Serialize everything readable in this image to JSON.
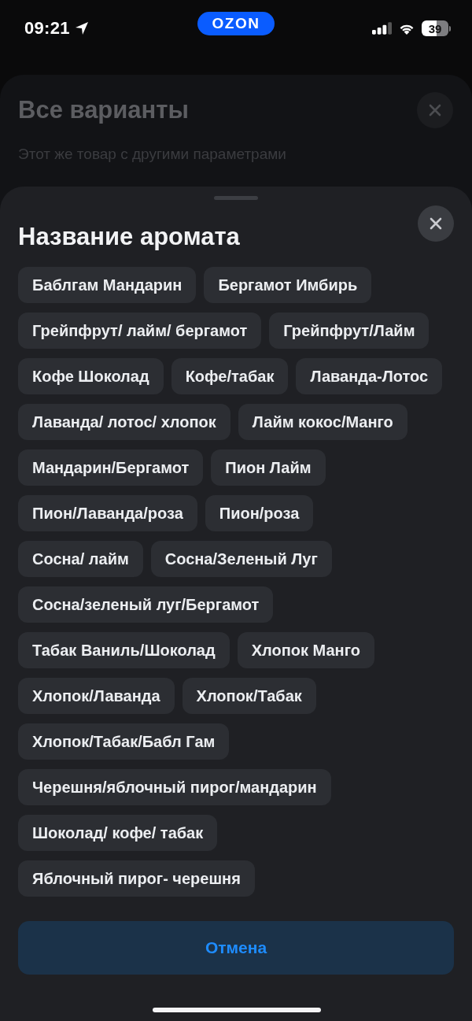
{
  "status_bar": {
    "time": "09:21",
    "app_badge": "OZON",
    "battery": "39"
  },
  "background_sheet": {
    "title": "Все варианты",
    "subtitle": "Этот же товар с другими параметрами"
  },
  "sheet": {
    "title": "Название аромата",
    "options": [
      {
        "label": "Баблгам Мандарин",
        "selected": false
      },
      {
        "label": "Бергамот Имбирь",
        "selected": false
      },
      {
        "label": "Грейпфрут/ лайм/ бергамот",
        "selected": false
      },
      {
        "label": "Грейпфрут/Лайм",
        "selected": false
      },
      {
        "label": "Кофе Шоколад",
        "selected": false
      },
      {
        "label": "Кофе/табак",
        "selected": false
      },
      {
        "label": "Лаванда-Лотос",
        "selected": false
      },
      {
        "label": "Лаванда/ лотос/ хлопок",
        "selected": false
      },
      {
        "label": "Лайм кокос/Манго",
        "selected": false
      },
      {
        "label": "Мандарин/Бергамот",
        "selected": false
      },
      {
        "label": "Пион Лайм",
        "selected": false
      },
      {
        "label": "Пион/Лаванда/роза",
        "selected": false
      },
      {
        "label": "Пион/роза",
        "selected": false
      },
      {
        "label": "Сосна/ лайм",
        "selected": false
      },
      {
        "label": "Сосна/Зеленый Луг",
        "selected": false
      },
      {
        "label": "Сосна/зеленый луг/Бергамот",
        "selected": false
      },
      {
        "label": "Табак Ваниль/Шоколад",
        "selected": false
      },
      {
        "label": "Хлопок Манго",
        "selected": false
      },
      {
        "label": "Хлопок/Лаванда",
        "selected": false
      },
      {
        "label": "Хлопок/Табак",
        "selected": false
      },
      {
        "label": "Хлопок/Табак/Бабл Гам",
        "selected": false
      },
      {
        "label": "Черешня/яблочный пирог/мандарин",
        "selected": false
      },
      {
        "label": "Шоколад/ кофе/ табак",
        "selected": false
      },
      {
        "label": "Яблочный пирог- черешня",
        "selected": false
      }
    ],
    "cancel_button": "Отмена"
  }
}
